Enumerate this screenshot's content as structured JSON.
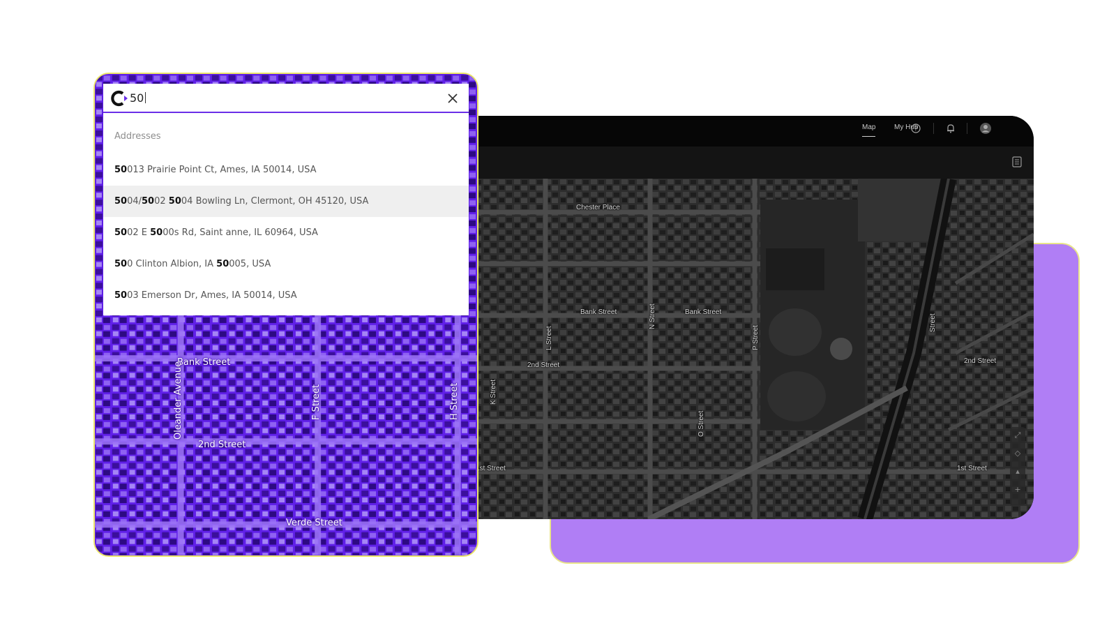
{
  "map_app": {
    "nav": {
      "map_label": "Map",
      "myhub_label": "My Hub",
      "help_icon": "help-circle-icon",
      "notification_icon": "bell-icon",
      "avatar_icon": "user-avatar-icon"
    },
    "panel_icon": "document-panel-icon",
    "street_labels": [
      "Chester Place",
      "Bank Street",
      "Bank Street",
      "2nd Street",
      "L Street",
      "N Street",
      "P Street",
      "K Street",
      "O Street",
      "1st Street",
      "1st Street",
      "2nd Street",
      "Street"
    ],
    "controls": [
      "expand-icon",
      "compass-icon",
      "location-icon",
      "zoom-in-icon"
    ]
  },
  "search": {
    "query": "50",
    "logo_icon": "brand-c-logo-icon",
    "close_icon": "close-icon",
    "section_heading": "Addresses",
    "results": [
      {
        "segments": [
          {
            "t": "50",
            "b": true
          },
          {
            "t": "013 Prairie Point Ct, Ames, IA 50014, USA",
            "b": false
          }
        ]
      },
      {
        "segments": [
          {
            "t": "50",
            "b": true
          },
          {
            "t": "04/",
            "b": false
          },
          {
            "t": "50",
            "b": true
          },
          {
            "t": "02 ",
            "b": false
          },
          {
            "t": "50",
            "b": true
          },
          {
            "t": "04 Bowling Ln, Clermont, OH 45120, USA",
            "b": false
          }
        ],
        "highlighted": true
      },
      {
        "segments": [
          {
            "t": "50",
            "b": true
          },
          {
            "t": "02 E ",
            "b": false
          },
          {
            "t": "50",
            "b": true
          },
          {
            "t": "00s Rd, Saint anne, IL 60964, USA",
            "b": false
          }
        ]
      },
      {
        "segments": [
          {
            "t": "50",
            "b": true
          },
          {
            "t": "0 Clinton Albion, IA ",
            "b": false
          },
          {
            "t": "50",
            "b": true
          },
          {
            "t": "005, USA",
            "b": false
          }
        ]
      },
      {
        "segments": [
          {
            "t": "50",
            "b": true
          },
          {
            "t": "03 Emerson Dr, Ames, IA 50014, USA",
            "b": false
          }
        ]
      }
    ]
  },
  "front_map_labels": [
    "Bank Street",
    "Oleander Avenue",
    "F Street",
    "H Street",
    "2nd Street",
    "Verde Street"
  ],
  "colors": {
    "accent_purple": "#5b17e0",
    "back_card_purple": "#b07ef5",
    "card_border_yellow": "#ebe568",
    "map_dark": "#2a2a2a"
  }
}
